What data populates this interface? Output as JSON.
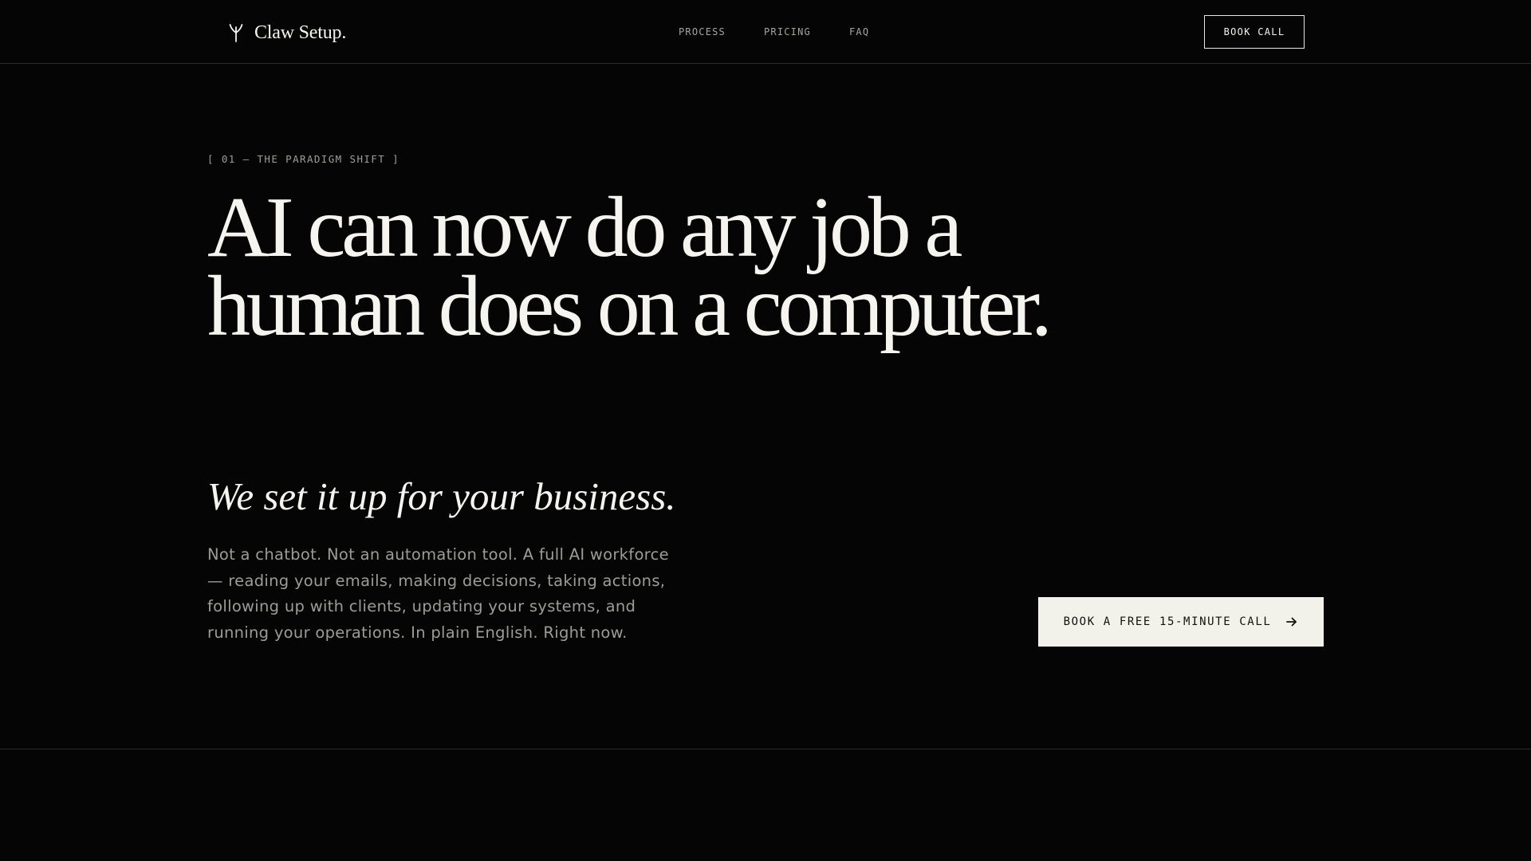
{
  "header": {
    "brand_name": "Claw Setup.",
    "brand_icon": "forked-branch-icon",
    "nav": [
      {
        "label": "PROCESS"
      },
      {
        "label": "PRICING"
      },
      {
        "label": "FAQ"
      }
    ],
    "cta_label": "BOOK CALL"
  },
  "hero": {
    "eyebrow": "[ 01 — THE PARADIGM SHIFT ]",
    "headline": "AI can now do any job a human does on a computer.",
    "subheadline": "We set it up for your business.",
    "body": "Not a chatbot. Not an automation tool. A full AI workforce — reading your emails, making decisions, taking actions, following up with clients, updating your systems, and running your operations. In plain English. Right now.",
    "cta_label": "BOOK A FREE 15-MINUTE CALL",
    "cta_icon": "arrow-right-icon"
  },
  "colors": {
    "background": "#050505",
    "text_primary": "#f5f4ee",
    "text_muted": "#9d9c96",
    "button_fill": "#f2f1ea",
    "divider": "#2c2c2a"
  }
}
